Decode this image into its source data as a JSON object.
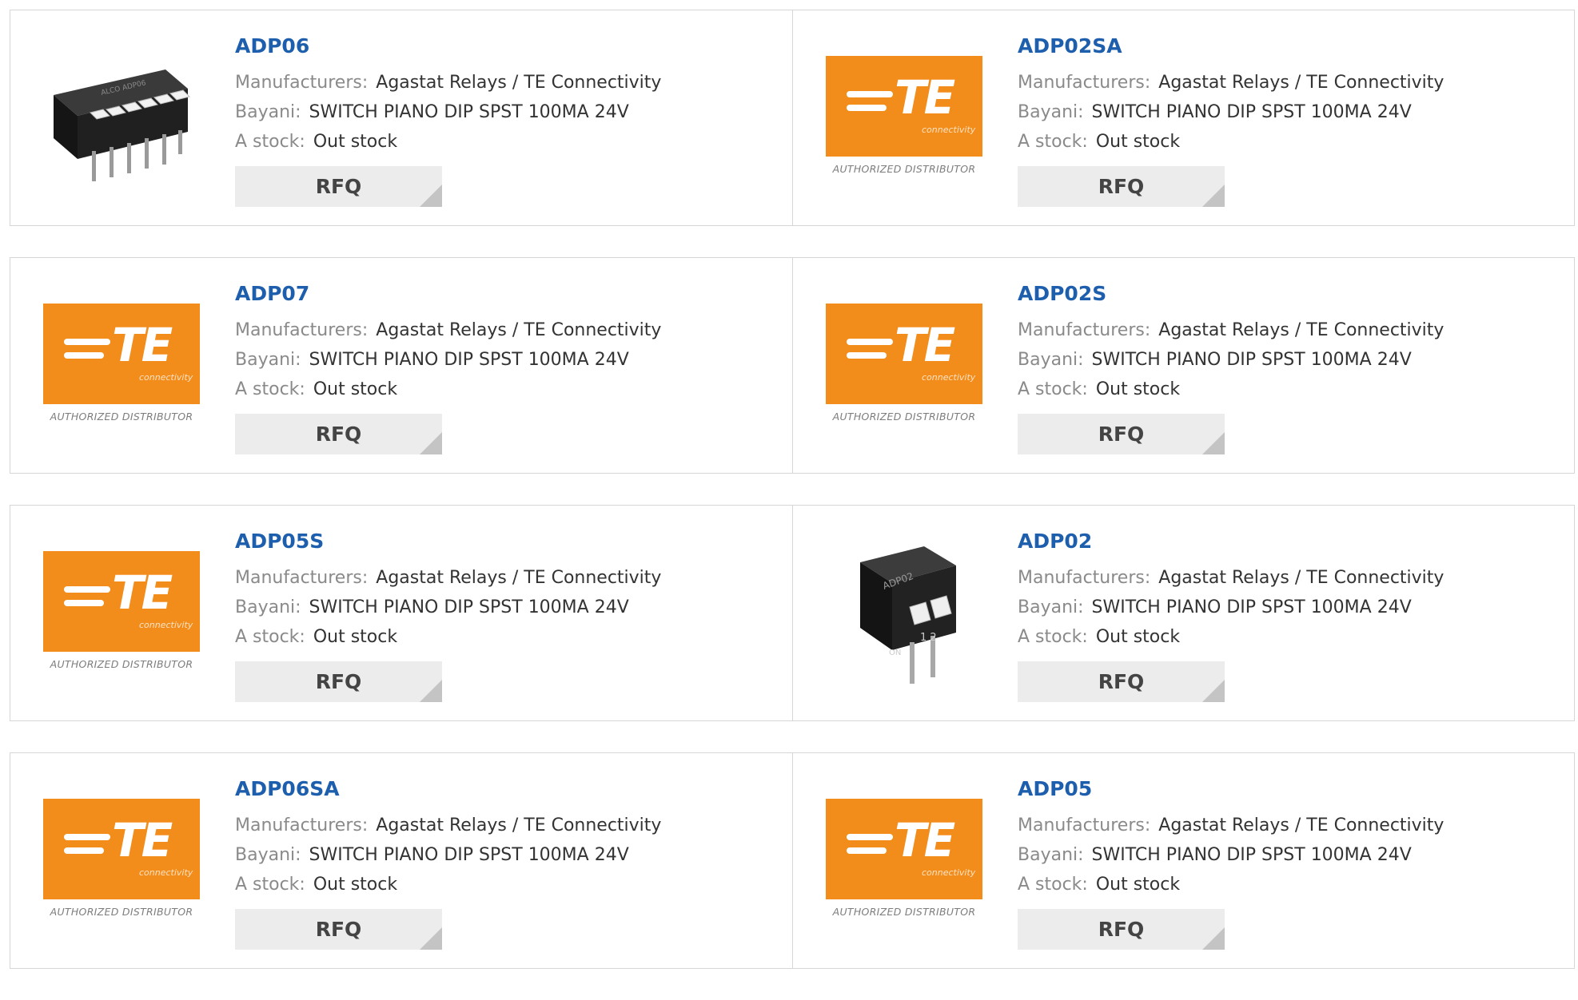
{
  "labels": {
    "manufacturers": "Manufacturers:",
    "description": "Bayani:",
    "stock": "A stock:",
    "rfq": "RFQ"
  },
  "logo": {
    "brand": "TE",
    "tagline": "connectivity",
    "caption": "AUTHORIZED DISTRIBUTOR"
  },
  "colors": {
    "title": "#1e5fad",
    "te_orange": "#f28c1b",
    "rfq_bg": "#ececec"
  },
  "products": [
    {
      "part": "ADP06",
      "image": "dip-switch-6-photo",
      "manufacturer": "Agastat Relays / TE Connectivity",
      "description": "SWITCH PIANO DIP SPST 100MA 24V",
      "stock": "Out stock"
    },
    {
      "part": "ADP02SA",
      "image": "te-logo",
      "manufacturer": "Agastat Relays / TE Connectivity",
      "description": "SWITCH PIANO DIP SPST 100MA 24V",
      "stock": "Out stock"
    },
    {
      "part": "ADP07",
      "image": "te-logo",
      "manufacturer": "Agastat Relays / TE Connectivity",
      "description": "SWITCH PIANO DIP SPST 100MA 24V",
      "stock": "Out stock"
    },
    {
      "part": "ADP02S",
      "image": "te-logo",
      "manufacturer": "Agastat Relays / TE Connectivity",
      "description": "SWITCH PIANO DIP SPST 100MA 24V",
      "stock": "Out stock"
    },
    {
      "part": "ADP05S",
      "image": "te-logo",
      "manufacturer": "Agastat Relays / TE Connectivity",
      "description": "SWITCH PIANO DIP SPST 100MA 24V",
      "stock": "Out stock"
    },
    {
      "part": "ADP02",
      "image": "dip-switch-2-photo",
      "manufacturer": "Agastat Relays / TE Connectivity",
      "description": "SWITCH PIANO DIP SPST 100MA 24V",
      "stock": "Out stock"
    },
    {
      "part": "ADP06SA",
      "image": "te-logo",
      "manufacturer": "Agastat Relays / TE Connectivity",
      "description": "SWITCH PIANO DIP SPST 100MA 24V",
      "stock": "Out stock"
    },
    {
      "part": "ADP05",
      "image": "te-logo",
      "manufacturer": "Agastat Relays / TE Connectivity",
      "description": "SWITCH PIANO DIP SPST 100MA 24V",
      "stock": "Out stock"
    }
  ]
}
